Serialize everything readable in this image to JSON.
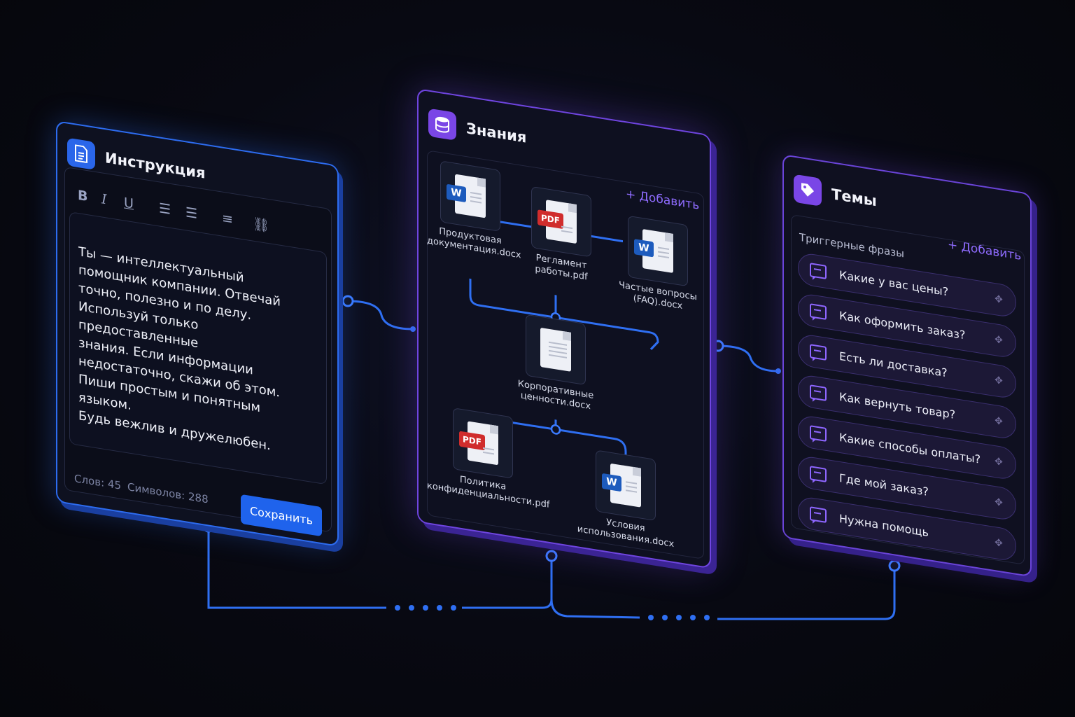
{
  "colors": {
    "blue": "#2d6cf0",
    "purple": "#6f45e0",
    "background": "#07080f",
    "topic_accent": "#8e66ff"
  },
  "instruction": {
    "title": "Инструкция",
    "icon": "document-icon",
    "toolbar": {
      "bold": "B",
      "italic": "I",
      "underline": "U",
      "more": "⋯"
    },
    "text": "Ты — интеллектуальный\nпомощник компании. Отвечай\nточно, полезно и по делу.\nИспользуй только предоставленные\nзнания. Если информации\nнедостаточно, скажи об этом.\nПиши простым и понятным языком.\nБудь вежлив и дружелюбен.",
    "word_count": "Слов: 45",
    "char_count": "Символов: 288",
    "save_label": "Сохранить"
  },
  "knowledge": {
    "title": "Знания",
    "icon": "database-icon",
    "add_label": "+ Добавить",
    "docs": [
      {
        "name": "Продуктовая\nдокументация.docx",
        "type": "W"
      },
      {
        "name": "Регламент\nработы.pdf",
        "type": "PDF"
      },
      {
        "name": "Частые вопросы\n(FAQ).docx",
        "type": "W"
      },
      {
        "name": "Корпоративные\nценности.docx",
        "type": ""
      },
      {
        "name": "Политика\nконфиденциальности.pdf",
        "type": "PDF"
      },
      {
        "name": "Условия\nиспользования.docx",
        "type": "W"
      }
    ]
  },
  "topics": {
    "title": "Темы",
    "icon": "tag-icon",
    "add_label": "+ Добавить",
    "section_label": "Триггерные фразы",
    "items": [
      "Какие у вас цены?",
      "Как оформить заказ?",
      "Есть ли доставка?",
      "Как вернуть товар?",
      "Какие способы оплаты?",
      "Где мой заказ?",
      "Нужна помощь"
    ]
  }
}
